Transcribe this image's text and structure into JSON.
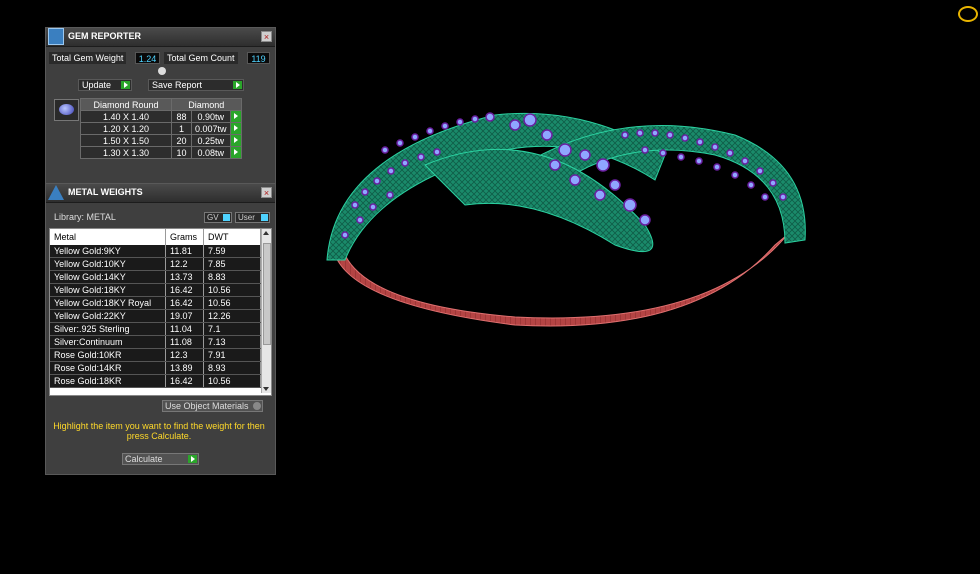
{
  "gem_reporter": {
    "title": "GEM REPORTER",
    "total_weight_label": "Total Gem Weight",
    "total_weight_value": "1.24",
    "total_count_label": "Total Gem Count",
    "total_count_value": "119",
    "update_label": "Update",
    "save_report_label": "Save Report",
    "table_headers": [
      "Diamond Round",
      "Diamond"
    ],
    "rows": [
      {
        "size": "1.40 X 1.40",
        "count": "88",
        "weight": "0.90tw"
      },
      {
        "size": "1.20 X 1.20",
        "count": "1",
        "weight": "0.007tw"
      },
      {
        "size": "1.50 X 1.50",
        "count": "20",
        "weight": "0.25tw"
      },
      {
        "size": "1.30 X 1.30",
        "count": "10",
        "weight": "0.08tw"
      }
    ]
  },
  "metal_weights": {
    "title": "METAL WEIGHTS",
    "library_label": "Library: METAL",
    "gv_label": "GV",
    "user_label": "User",
    "columns": [
      "Metal",
      "Grams",
      "DWT"
    ],
    "rows": [
      {
        "metal": "Yellow Gold:9KY",
        "grams": "11.81",
        "dwt": "7.59"
      },
      {
        "metal": "Yellow Gold:10KY",
        "grams": "12.2",
        "dwt": "7.85"
      },
      {
        "metal": "Yellow Gold:14KY",
        "grams": "13.73",
        "dwt": "8.83"
      },
      {
        "metal": "Yellow Gold:18KY",
        "grams": "16.42",
        "dwt": "10.56"
      },
      {
        "metal": "Yellow Gold:18KY Royal",
        "grams": "16.42",
        "dwt": "10.56"
      },
      {
        "metal": "Yellow Gold:22KY",
        "grams": "19.07",
        "dwt": "12.26"
      },
      {
        "metal": "Silver:.925 Sterling",
        "grams": "11.04",
        "dwt": "7.1"
      },
      {
        "metal": "Silver:Continuum",
        "grams": "11.08",
        "dwt": "7.13"
      },
      {
        "metal": "Rose Gold:10KR",
        "grams": "12.3",
        "dwt": "7.91"
      },
      {
        "metal": "Rose Gold:14KR",
        "grams": "13.89",
        "dwt": "8.93"
      },
      {
        "metal": "Rose Gold:18KR",
        "grams": "16.42",
        "dwt": "10.56"
      }
    ],
    "use_object_label": "Use Object Materials",
    "instruction": "Highlight the item you want to find the weight for then press Calculate.",
    "calculate_label": "Calculate"
  },
  "icons": {
    "gem_reporter": "gem-reporter-icon",
    "metal": "metal-weights-icon",
    "diamond": "round-diamond-icon",
    "viewport_gem": "gem-widget-icon"
  }
}
